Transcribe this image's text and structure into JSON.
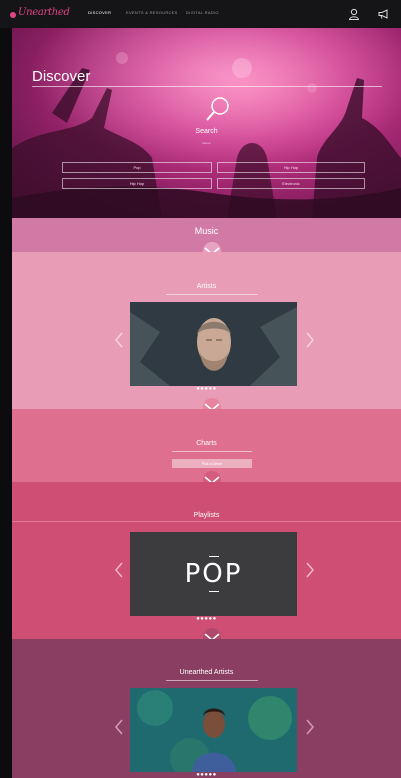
{
  "nav": {
    "logo_text": "Unearthed",
    "links": [
      "DISCOVER",
      "EVENTS & RESOURCES",
      "DIGITAL RADIO"
    ],
    "icons": [
      "user-icon",
      "megaphone-icon"
    ]
  },
  "hero": {
    "title": "Discover",
    "search_label": "Search",
    "search_sub": "Genre",
    "fields": [
      "Pop",
      "Hip Hop",
      "Hip Hop",
      "Electronic"
    ]
  },
  "sections": {
    "music": {
      "title": "Music"
    },
    "artists": {
      "title": "Artists",
      "dots": "●●●●●"
    },
    "charts": {
      "title": "Charts",
      "pill": "Pick a Genre"
    },
    "playlists": {
      "title": "Playlists",
      "card_text": "POP",
      "dots": "●●●●●"
    },
    "unearthed_artists": {
      "title": "Unearthed Artists",
      "dots": "●●●●●"
    }
  },
  "colors": {
    "accent": "#e24486",
    "music_bg": "#d27aa6",
    "artists_bg": "#e89cb6",
    "charts_bg": "#df6f8f",
    "playlists_bg": "#cf4f74",
    "unearthed_bg": "#8a3f62"
  }
}
